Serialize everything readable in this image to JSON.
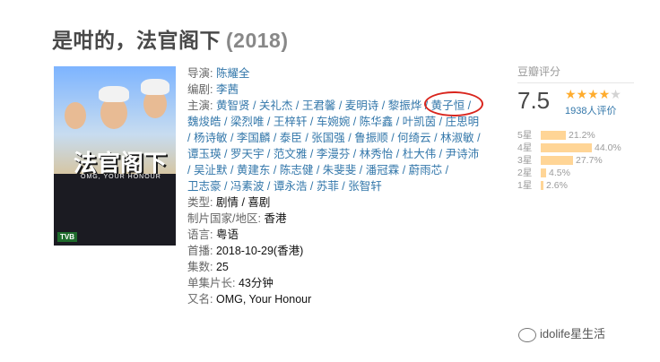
{
  "title": "是咁的，法官阁下",
  "year": "(2018)",
  "poster": {
    "title": "法官阁下",
    "subtitle": "OMG, YOUR HONOUR",
    "logo": "TVB"
  },
  "labels": {
    "director": "导演:",
    "writer": "编剧:",
    "cast": "主演:",
    "genre": "类型:",
    "country": "制片国家/地区:",
    "language": "语言:",
    "premiere": "首播:",
    "episodes": "集数:",
    "runtime": "单集片长:",
    "aka": "又名:"
  },
  "director": "陈耀全",
  "writer": "李茜",
  "cast": [
    "黄智贤",
    "关礼杰",
    "王君馨",
    "麦明诗",
    "黎振烨",
    "黄子恒",
    "魏焌皓",
    "梁烈唯",
    "王梓轩",
    "车婉婉",
    "陈华鑫",
    "叶凯茵",
    "庄思明",
    "杨诗敏",
    "李国麟",
    "泰臣",
    "张国强",
    "鲁振顺",
    "何绮云",
    "林淑敏",
    "谭玉瑛",
    "罗天宇",
    "范文雅",
    "李漫芬",
    "林秀怡",
    "杜大伟",
    "尹诗沛",
    "吴沚默",
    "黄建东",
    "陈志健",
    "朱斐斐",
    "潘冠霖",
    "蔚雨芯",
    "卫志豪",
    "冯素波",
    "谭永浩",
    "苏菲",
    "张智轩"
  ],
  "genres": [
    "剧情",
    "喜剧"
  ],
  "country": "香港",
  "language": "粤语",
  "premiere": "2018-10-29(香港)",
  "episodes": "25",
  "runtime": "43分钟",
  "aka": "OMG, Your Honour",
  "rating": {
    "label": "豆瓣评分",
    "score": "7.5",
    "stars_filled": 4,
    "stars_total": 5,
    "count": "1938人评价",
    "breakdown": [
      {
        "label": "5星",
        "pct": "21.2%",
        "value": 21.2
      },
      {
        "label": "4星",
        "pct": "44.0%",
        "value": 44.0
      },
      {
        "label": "3星",
        "pct": "27.7%",
        "value": 27.7
      },
      {
        "label": "2星",
        "pct": "4.5%",
        "value": 4.5
      },
      {
        "label": "1星",
        "pct": "2.6%",
        "value": 2.6
      }
    ]
  },
  "watermark": "idolife星生活"
}
